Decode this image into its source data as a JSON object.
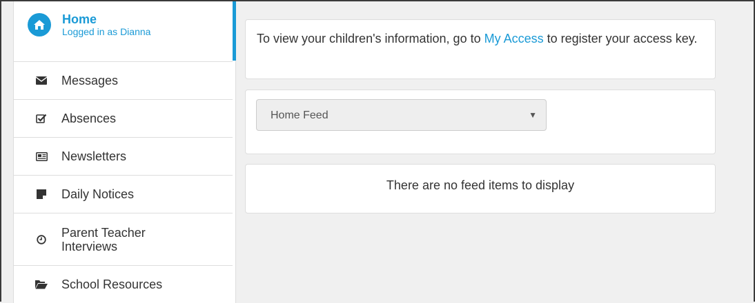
{
  "sidebar": {
    "home": {
      "title": "Home",
      "subtitle": "Logged in as Dianna",
      "icon": "home-icon"
    },
    "items": [
      {
        "label": "Messages",
        "icon": "envelope-icon"
      },
      {
        "label": "Absences",
        "icon": "checkbox-icon"
      },
      {
        "label": "Newsletters",
        "icon": "newspaper-icon"
      },
      {
        "label": "Daily Notices",
        "icon": "sticky-note-icon"
      },
      {
        "label": "Parent Teacher Interviews",
        "icon": "clock-icon"
      },
      {
        "label": "School Resources",
        "icon": "folder-open-icon"
      }
    ]
  },
  "main": {
    "notice": {
      "text_before": "To view your children's information, go to ",
      "link": "My Access",
      "text_after": " to register your access key."
    },
    "feed_select": {
      "selected": "Home Feed"
    },
    "feed_empty": "There are no feed items to display"
  },
  "colors": {
    "accent": "#1a9ad6",
    "text": "#333333",
    "background": "#f0f0f0"
  }
}
